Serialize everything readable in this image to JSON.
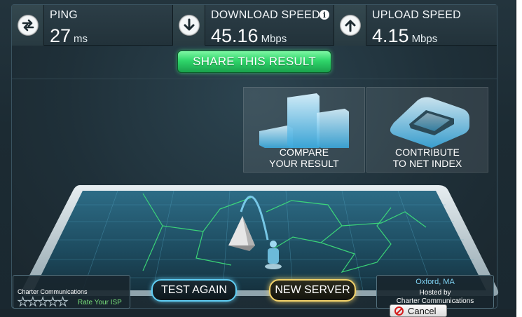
{
  "stats": {
    "ping": {
      "label": "PING",
      "value": "27",
      "unit": "ms",
      "icon": "ping-arrows-icon"
    },
    "download": {
      "label": "DOWNLOAD SPEED",
      "value": "45.16",
      "unit": "Mbps",
      "icon": "download-arrow-icon"
    },
    "upload": {
      "label": "UPLOAD SPEED",
      "value": "4.15",
      "unit": "Mbps",
      "icon": "upload-arrow-icon"
    }
  },
  "share": {
    "label": "SHARE THIS RESULT"
  },
  "tiles": {
    "compare": {
      "line1": "COMPARE",
      "line2": "YOUR RESULT"
    },
    "contribute": {
      "line1": "CONTRIBUTE",
      "line2": "TO NET INDEX"
    }
  },
  "isp": {
    "name": "Charter Communications",
    "rate_label": "Rate Your ISP",
    "stars": "★★★★★"
  },
  "controls": {
    "test_again": "TEST AGAIN",
    "new_server": "NEW SERVER"
  },
  "server": {
    "city": "Oxford, MA",
    "hosted_by": "Hosted by",
    "host": "Charter Communications"
  },
  "cancel": {
    "label": "Cancel"
  },
  "colors": {
    "share_green": "#2fd56a",
    "test_again_glow": "#5fcdf3",
    "new_server_glow": "#f3d36a",
    "map_line_green": "#3ee27a",
    "server_city": "#7fd3f3"
  }
}
